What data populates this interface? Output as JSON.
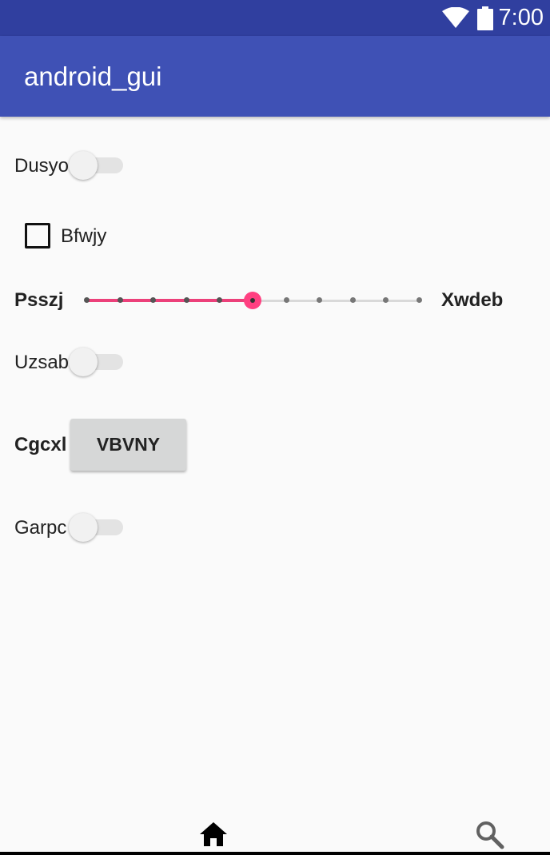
{
  "status_bar": {
    "time": "7:00",
    "icons": [
      "wifi-icon",
      "battery-icon"
    ]
  },
  "app_bar": {
    "title": "android_gui"
  },
  "rows": {
    "switch1": {
      "label": "Dusyo",
      "checked": false
    },
    "checkbox1": {
      "label": "Bfwjy",
      "checked": false
    },
    "slider1": {
      "label_start": "Psszj",
      "label_end": "Xwdeb",
      "value": 5,
      "max": 10
    },
    "switch2": {
      "label": "Uzsab",
      "checked": false
    },
    "button_row": {
      "label": "Cgcxl",
      "button_label": "VBVNY"
    },
    "switch3": {
      "label": "Garpc",
      "checked": false
    }
  },
  "bottom_nav": {
    "items": [
      "home-icon",
      "search-icon"
    ]
  },
  "colors": {
    "status_bar": "#303f9f",
    "app_bar": "#3f51b5",
    "accent": "#ff4081",
    "background": "#fafafa"
  }
}
